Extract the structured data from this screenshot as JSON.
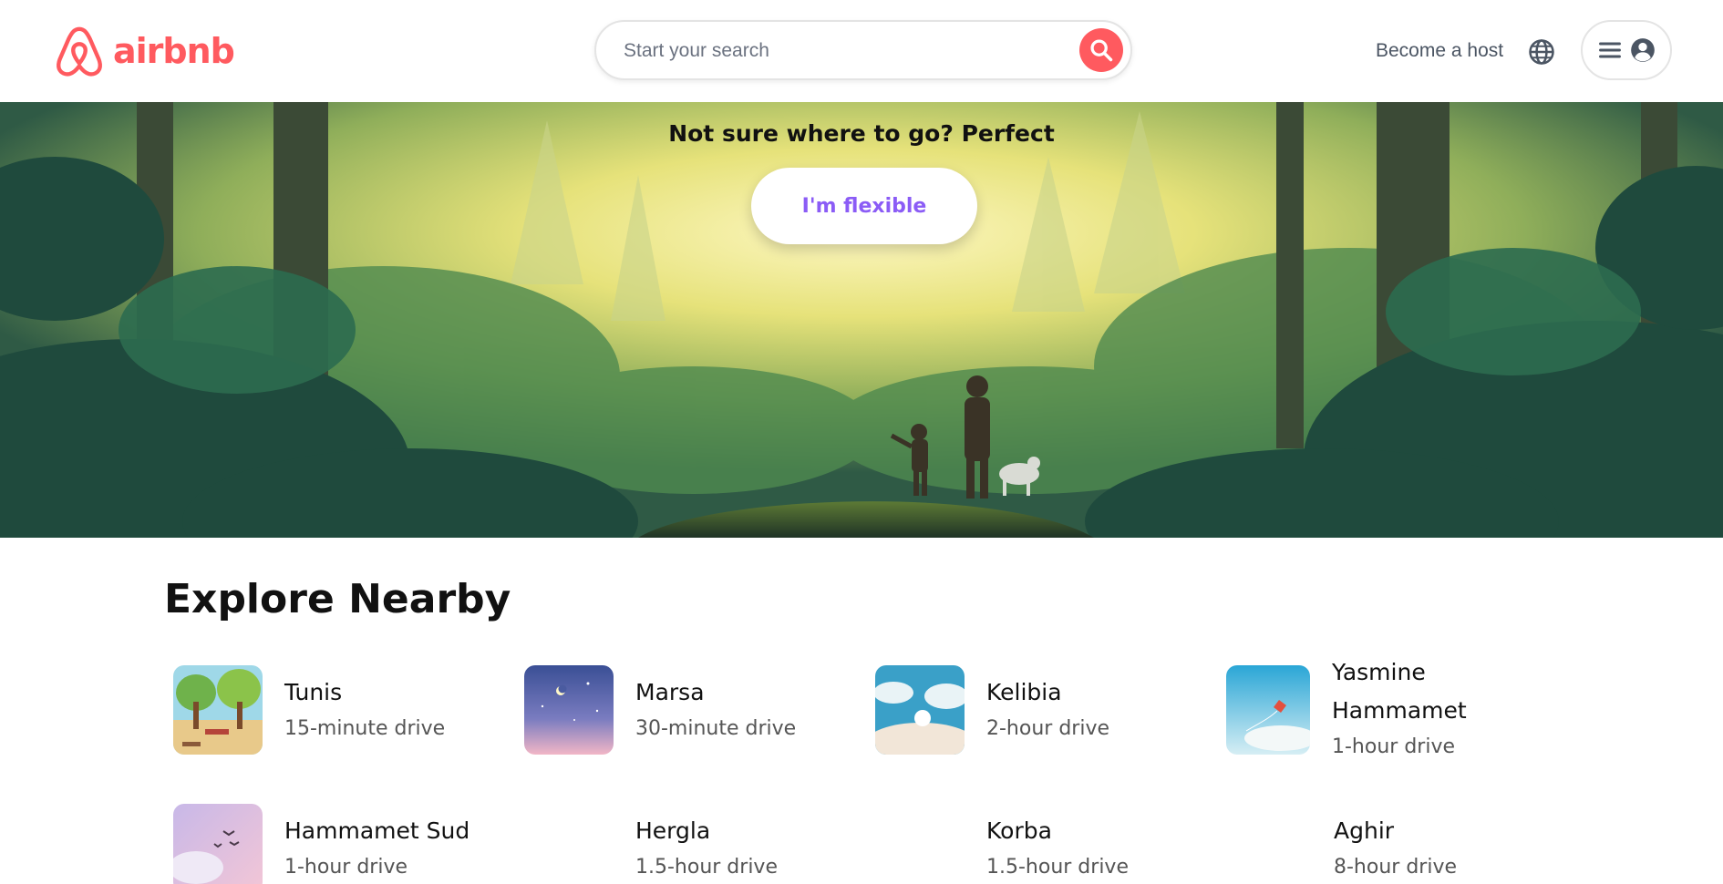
{
  "header": {
    "logo_text": "airbnb",
    "search_placeholder": "Start your search",
    "host_label": "Become a host",
    "brand_color": "#FF5A5F"
  },
  "hero": {
    "title": "Not sure where to go? Perfect",
    "button_label": "I'm flexible",
    "button_color": "#8b5cf6"
  },
  "explore": {
    "title": "Explore Nearby",
    "items": [
      {
        "name": "Tunis",
        "distance": "15-minute drive",
        "thumb": "park"
      },
      {
        "name": "Marsa",
        "distance": "30-minute drive",
        "thumb": "night-sky"
      },
      {
        "name": "Kelibia",
        "distance": "2-hour drive",
        "thumb": "clouds"
      },
      {
        "name": "Yasmine Hammamet",
        "distance": "1-hour drive",
        "thumb": "kite"
      },
      {
        "name": "Hammamet Sud",
        "distance": "1-hour drive",
        "thumb": "birds"
      },
      {
        "name": "Hergla",
        "distance": "1.5-hour drive",
        "thumb": ""
      },
      {
        "name": "Korba",
        "distance": "1.5-hour drive",
        "thumb": ""
      },
      {
        "name": "Aghir",
        "distance": "8-hour drive",
        "thumb": ""
      }
    ]
  }
}
